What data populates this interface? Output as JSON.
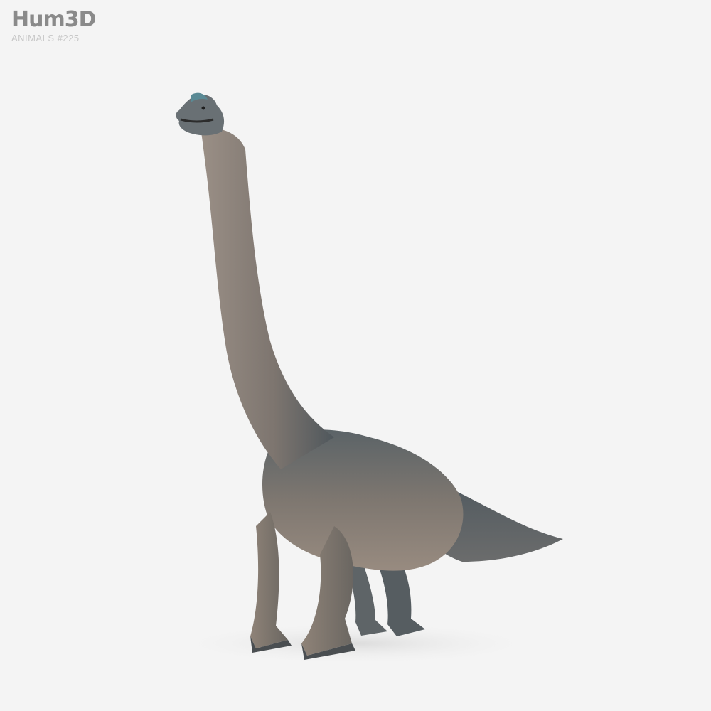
{
  "brand": {
    "logo": "Hum3D",
    "category": "ANIMALS",
    "number": "#225"
  },
  "colors": {
    "background": "#f4f4f4",
    "logo": "#8a8a8a",
    "subtitle": "#c7c7c7",
    "skin_dark": "#5d6468",
    "skin_light": "#8c8178",
    "shadow": "#e6e6e6"
  },
  "scene": {
    "subject": "brachiosaurus-3d-model"
  }
}
